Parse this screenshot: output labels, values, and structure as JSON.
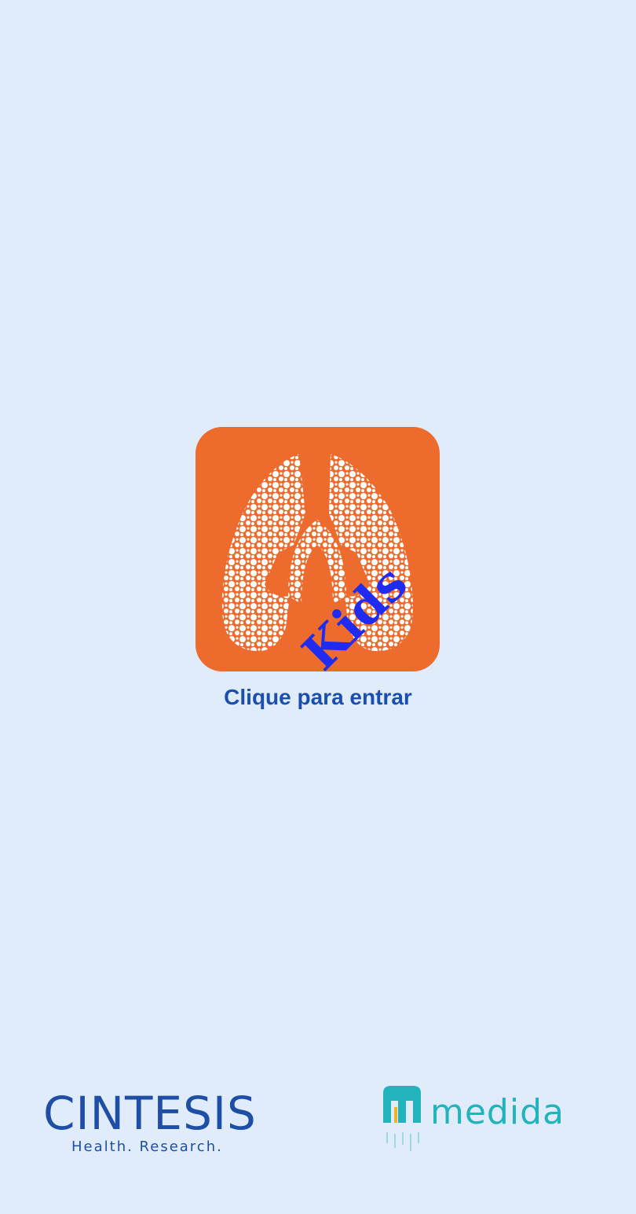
{
  "app_icon": {
    "badge_text": "Kids",
    "background_color": "#ee6b2e",
    "badge_color": "#1f2cf0"
  },
  "enter": {
    "label": "Clique para entrar"
  },
  "partners": {
    "cintesis": {
      "name": "CINTESIS",
      "tagline": "Health. Research."
    },
    "medida": {
      "name": "medida"
    }
  },
  "colors": {
    "background": "#e1ecfb",
    "label": "#1a4fb0",
    "cintesis": "#1f4ea6",
    "medida": "#22b3bd"
  }
}
